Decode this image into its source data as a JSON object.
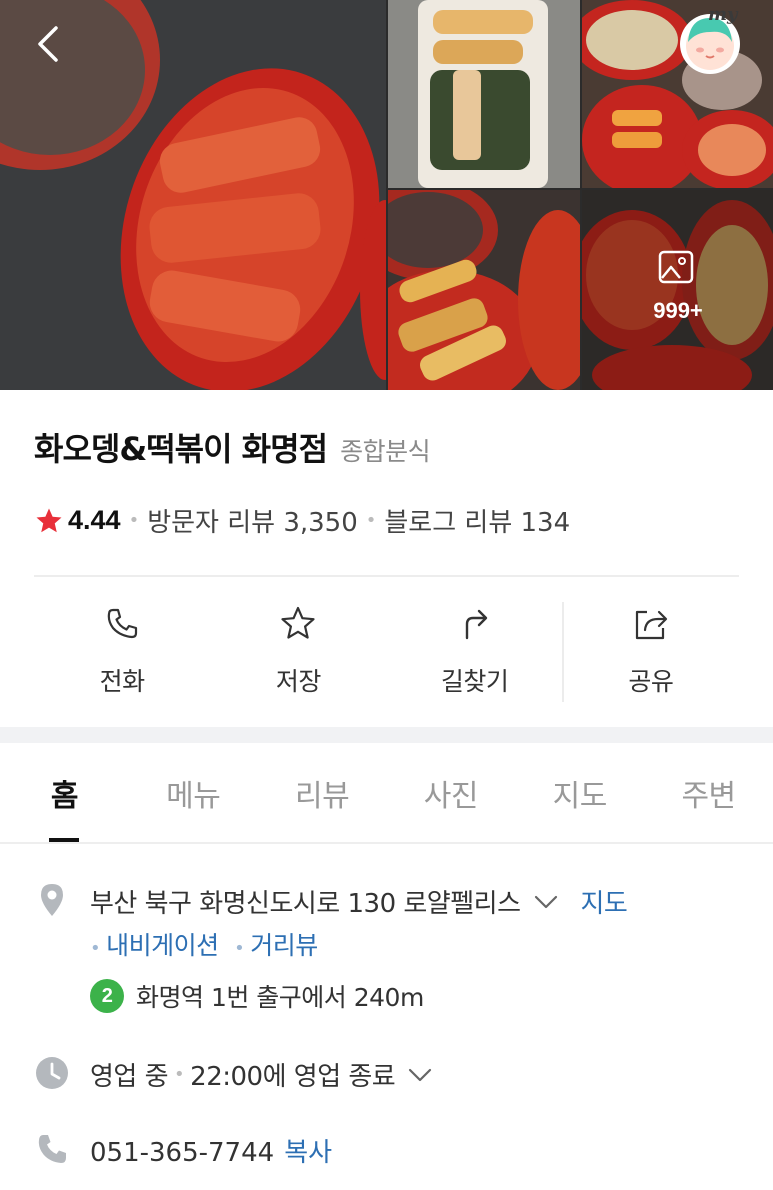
{
  "gallery": {
    "back_icon": "chevron-left-icon",
    "my_icon": "my-avatar-icon",
    "my_label": "my",
    "more_icon": "image-icon",
    "more_count": "999+"
  },
  "place": {
    "name": "화오뎅&떡볶이 화명점",
    "category": "종합분식",
    "rating_icon": "star-icon",
    "rating": "4.44",
    "visitor_reviews": "방문자 리뷰 3,350",
    "blog_reviews": "블로그 리뷰 134"
  },
  "actions": [
    {
      "label": "전화",
      "icon": "phone-icon"
    },
    {
      "label": "저장",
      "icon": "star-outline-icon"
    },
    {
      "label": "길찾기",
      "icon": "directions-icon"
    },
    {
      "label": "공유",
      "icon": "share-icon"
    }
  ],
  "tabs": [
    {
      "label": "홈",
      "active": true
    },
    {
      "label": "메뉴"
    },
    {
      "label": "리뷰"
    },
    {
      "label": "사진"
    },
    {
      "label": "지도"
    },
    {
      "label": "주변"
    }
  ],
  "info": {
    "address": "부산 북구 화명신도시로 130 로얄펠리스",
    "map_link": "지도",
    "navigation_link": "내비게이션",
    "streetview_link": "거리뷰",
    "subway_line": "2",
    "subway_text": "화명역 1번 출구에서 240m",
    "status": "영업 중",
    "closing": "22:00에 영업 종료",
    "phone": "051-365-7744",
    "copy_label": "복사"
  },
  "colors": {
    "accent_link": "#2d6fb3",
    "star": "#e8303a",
    "subway_line_2": "#3cb24a"
  }
}
